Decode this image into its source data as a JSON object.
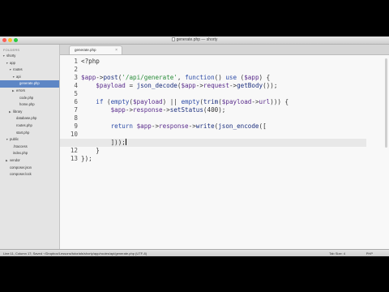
{
  "window": {
    "title": "generate.php — shorty"
  },
  "sidebar": {
    "header": "FOLDERS",
    "items": [
      {
        "label": "shorty",
        "arrow": "▼",
        "depth": 0
      },
      {
        "label": "app",
        "arrow": "▼",
        "depth": 1
      },
      {
        "label": "routes",
        "arrow": "▼",
        "depth": 2
      },
      {
        "label": "api",
        "arrow": "▼",
        "depth": 3
      },
      {
        "label": "generate.php",
        "arrow": "",
        "depth": 4,
        "selected": true
      },
      {
        "label": "errors",
        "arrow": "▶",
        "depth": 3
      },
      {
        "label": "code.php",
        "arrow": "",
        "depth": 4
      },
      {
        "label": "home.php",
        "arrow": "",
        "depth": 4
      },
      {
        "label": "library",
        "arrow": "▶",
        "depth": 2
      },
      {
        "label": "database.php",
        "arrow": "",
        "depth": 3
      },
      {
        "label": "routes.php",
        "arrow": "",
        "depth": 3
      },
      {
        "label": "start.php",
        "arrow": "",
        "depth": 3
      },
      {
        "label": "public",
        "arrow": "▼",
        "depth": 1
      },
      {
        "label": ".htaccess",
        "arrow": "",
        "depth": 2
      },
      {
        "label": "index.php",
        "arrow": "",
        "depth": 2
      },
      {
        "label": "vendor",
        "arrow": "▶",
        "depth": 1
      },
      {
        "label": "composer.json",
        "arrow": "",
        "depth": 1
      },
      {
        "label": "composer.lock",
        "arrow": "",
        "depth": 1
      }
    ]
  },
  "tabs": [
    {
      "label": "generate.php",
      "close": "×"
    }
  ],
  "editor": {
    "line_numbers": [
      "1",
      "2",
      "3",
      "4",
      "5",
      "6",
      "7",
      "8",
      "9",
      "10",
      "11",
      "12",
      "13"
    ],
    "current_line": 11,
    "lines": [
      [
        {
          "t": "<?php",
          "c": "pl"
        }
      ],
      [],
      [
        {
          "t": "$app",
          "c": "var"
        },
        {
          "t": "->",
          "c": "pl"
        },
        {
          "t": "post",
          "c": "fn"
        },
        {
          "t": "(",
          "c": "pl"
        },
        {
          "t": "'/api/generate'",
          "c": "str"
        },
        {
          "t": ", ",
          "c": "pl"
        },
        {
          "t": "function",
          "c": "kw"
        },
        {
          "t": "() ",
          "c": "pl"
        },
        {
          "t": "use",
          "c": "kw"
        },
        {
          "t": " (",
          "c": "pl"
        },
        {
          "t": "$app",
          "c": "var"
        },
        {
          "t": ") {",
          "c": "pl"
        }
      ],
      [
        {
          "t": "    ",
          "c": "pl"
        },
        {
          "t": "$payload",
          "c": "var"
        },
        {
          "t": " = ",
          "c": "pl"
        },
        {
          "t": "json_decode",
          "c": "fn"
        },
        {
          "t": "(",
          "c": "pl"
        },
        {
          "t": "$app",
          "c": "var"
        },
        {
          "t": "->",
          "c": "pl"
        },
        {
          "t": "request",
          "c": "var"
        },
        {
          "t": "->",
          "c": "pl"
        },
        {
          "t": "getBody",
          "c": "fn"
        },
        {
          "t": "());",
          "c": "pl"
        }
      ],
      [],
      [
        {
          "t": "    ",
          "c": "pl"
        },
        {
          "t": "if",
          "c": "kw"
        },
        {
          "t": " (",
          "c": "pl"
        },
        {
          "t": "empty",
          "c": "kw"
        },
        {
          "t": "(",
          "c": "pl"
        },
        {
          "t": "$payload",
          "c": "var"
        },
        {
          "t": ") || ",
          "c": "pl"
        },
        {
          "t": "empty",
          "c": "kw"
        },
        {
          "t": "(",
          "c": "pl"
        },
        {
          "t": "trim",
          "c": "fn"
        },
        {
          "t": "(",
          "c": "pl"
        },
        {
          "t": "$payload",
          "c": "var"
        },
        {
          "t": "->",
          "c": "pl"
        },
        {
          "t": "url",
          "c": "var"
        },
        {
          "t": "))) {",
          "c": "pl"
        }
      ],
      [
        {
          "t": "        ",
          "c": "pl"
        },
        {
          "t": "$app",
          "c": "var"
        },
        {
          "t": "->",
          "c": "pl"
        },
        {
          "t": "response",
          "c": "var"
        },
        {
          "t": "->",
          "c": "pl"
        },
        {
          "t": "setStatus",
          "c": "fn"
        },
        {
          "t": "(400);",
          "c": "pl"
        }
      ],
      [],
      [
        {
          "t": "        ",
          "c": "pl"
        },
        {
          "t": "return",
          "c": "kw"
        },
        {
          "t": " ",
          "c": "pl"
        },
        {
          "t": "$app",
          "c": "var"
        },
        {
          "t": "->",
          "c": "pl"
        },
        {
          "t": "response",
          "c": "var"
        },
        {
          "t": "->",
          "c": "pl"
        },
        {
          "t": "write",
          "c": "fn"
        },
        {
          "t": "(",
          "c": "pl"
        },
        {
          "t": "json_encode",
          "c": "fn"
        },
        {
          "t": "([",
          "c": "pl"
        }
      ],
      [],
      [
        {
          "t": "        ",
          "c": "pl"
        },
        {
          "t": "]));",
          "c": "pl"
        }
      ],
      [
        {
          "t": "    }",
          "c": "pl"
        }
      ],
      [
        {
          "t": "});",
          "c": "pl"
        }
      ]
    ]
  },
  "status": {
    "left": "Line 11, Column 17; Saved ~/Dropbox/Lessons/tutorials/shorty/app/routes/api/generate.php (UTF-8)",
    "tab_size": "Tab Size: 4",
    "syntax": "PHP"
  },
  "colors": {
    "keyword": "#2f4da8",
    "variable": "#5a2c8c",
    "string": "#2a8d3a",
    "function": "#1c2f7e",
    "selection": "#5d86c5"
  }
}
